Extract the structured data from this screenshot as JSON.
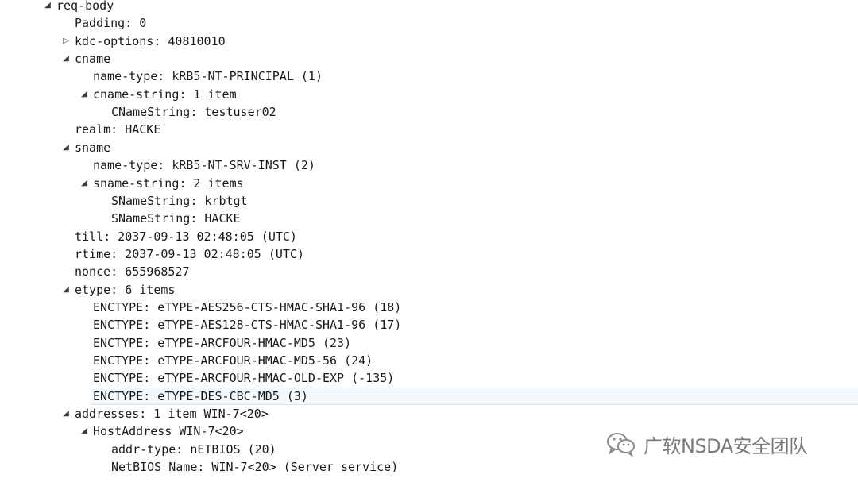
{
  "tree": [
    {
      "label": "req-body",
      "depth": 0,
      "toggle": "expanded"
    },
    {
      "label": "Padding: 0",
      "depth": 1,
      "toggle": null
    },
    {
      "label": "kdc-options: 40810010",
      "depth": 1,
      "toggle": "collapsed"
    },
    {
      "label": "cname",
      "depth": 1,
      "toggle": "expanded"
    },
    {
      "label": "name-type: kRB5-NT-PRINCIPAL (1)",
      "depth": 2,
      "toggle": null
    },
    {
      "label": "cname-string: 1 item",
      "depth": 2,
      "toggle": "expanded"
    },
    {
      "label": "CNameString: testuser02",
      "depth": 3,
      "toggle": null
    },
    {
      "label": "realm: HACKE",
      "depth": 1,
      "toggle": null
    },
    {
      "label": "sname",
      "depth": 1,
      "toggle": "expanded"
    },
    {
      "label": "name-type: kRB5-NT-SRV-INST (2)",
      "depth": 2,
      "toggle": null
    },
    {
      "label": "sname-string: 2 items",
      "depth": 2,
      "toggle": "expanded"
    },
    {
      "label": "SNameString: krbtgt",
      "depth": 3,
      "toggle": null
    },
    {
      "label": "SNameString: HACKE",
      "depth": 3,
      "toggle": null
    },
    {
      "label": "till: 2037-09-13 02:48:05 (UTC)",
      "depth": 1,
      "toggle": null
    },
    {
      "label": "rtime: 2037-09-13 02:48:05 (UTC)",
      "depth": 1,
      "toggle": null
    },
    {
      "label": "nonce: 655968527",
      "depth": 1,
      "toggle": null
    },
    {
      "label": "etype: 6 items",
      "depth": 1,
      "toggle": "expanded"
    },
    {
      "label": "ENCTYPE: eTYPE-AES256-CTS-HMAC-SHA1-96 (18)",
      "depth": 2,
      "toggle": null
    },
    {
      "label": "ENCTYPE: eTYPE-AES128-CTS-HMAC-SHA1-96 (17)",
      "depth": 2,
      "toggle": null
    },
    {
      "label": "ENCTYPE: eTYPE-ARCFOUR-HMAC-MD5 (23)",
      "depth": 2,
      "toggle": null
    },
    {
      "label": "ENCTYPE: eTYPE-ARCFOUR-HMAC-MD5-56 (24)",
      "depth": 2,
      "toggle": null
    },
    {
      "label": "ENCTYPE: eTYPE-ARCFOUR-HMAC-OLD-EXP (-135)",
      "depth": 2,
      "toggle": null
    },
    {
      "label": "ENCTYPE: eTYPE-DES-CBC-MD5 (3)",
      "depth": 2,
      "toggle": null,
      "selected": true
    },
    {
      "label": "addresses: 1 item WIN-7<20>",
      "depth": 1,
      "toggle": "expanded"
    },
    {
      "label": "HostAddress WIN-7<20>",
      "depth": 2,
      "toggle": "expanded"
    },
    {
      "label": "addr-type: nETBIOS (20)",
      "depth": 3,
      "toggle": null
    },
    {
      "label": "NetBIOS Name: WIN-7<20> (Server service)",
      "depth": 3,
      "toggle": null
    }
  ],
  "icons": {
    "expanded": "triangle-expanded-icon",
    "collapsed": "triangle-collapsed-icon"
  },
  "watermark": {
    "text": "广软NSDA安全团队",
    "icon": "wechat-icon"
  },
  "colors": {
    "selected_background": "#f3f9fd",
    "selected_border": "#cfe6f7",
    "text": "#1a1a1a",
    "watermark": "#7a7a7a"
  }
}
